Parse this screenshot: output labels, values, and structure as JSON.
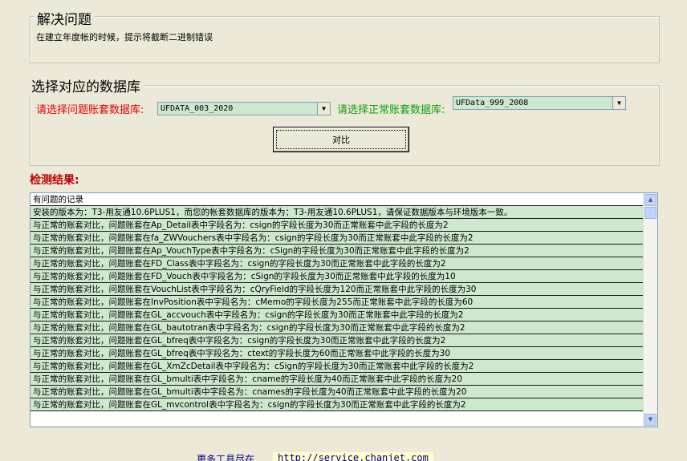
{
  "problem": {
    "title": "解决问题",
    "description": "在建立年度帐的时候，提示将截断二进制错误"
  },
  "database": {
    "title": "选择对应的数据库",
    "problem_label": "请选择问题账套数据库:",
    "problem_value": "UFDATA_003_2020",
    "normal_label": "请选择正常账套数据库:",
    "normal_value": "UFData_999_2008",
    "compare_button": "对比"
  },
  "results": {
    "title": "检测结果:",
    "header": "有问题的记录",
    "rows": [
      "安装的版本为：T3-用友通10.6PLUS1，而您的帐套数据库的版本为：T3-用友通10.6PLUS1，请保证数据版本与环境版本一致。",
      "与正常的账套对比，问题账套在Ap_Detail表中字段名为：csign的字段长度为30而正常账套中此字段的长度为2",
      "与正常的账套对比，问题账套在fa_ZWVouchers表中字段名为：csign的字段长度为30而正常账套中此字段的长度为2",
      "与正常的账套对比，问题账套在Ap_VouchType表中字段名为：cSign的字段长度为30而正常账套中此字段的长度为2",
      "与正常的账套对比，问题账套在FD_Class表中字段名为：csign的字段长度为30而正常账套中此字段的长度为2",
      "与正常的账套对比，问题账套在FD_Vouch表中字段名为：cSign的字段长度为30而正常账套中此字段的长度为10",
      "与正常的账套对比，问题账套在VouchList表中字段名为：cQryField的字段长度为120而正常账套中此字段的长度为30",
      "与正常的账套对比，问题账套在InvPosition表中字段名为：cMemo的字段长度为255而正常账套中此字段的长度为60",
      "与正常的账套对比，问题账套在GL_accvouch表中字段名为：csign的字段长度为30而正常账套中此字段的长度为2",
      "与正常的账套对比，问题账套在GL_bautotran表中字段名为：csign的字段长度为30而正常账套中此字段的长度为2",
      "与正常的账套对比，问题账套在GL_bfreq表中字段名为：csign的字段长度为30而正常账套中此字段的长度为2",
      "与正常的账套对比，问题账套在GL_bfreq表中字段名为：ctext的字段长度为60而正常账套中此字段的长度为30",
      "与正常的账套对比，问题账套在GL_XmZcDetail表中字段名为：cSign的字段长度为30而正常账套中此字段的长度为2",
      "与正常的账套对比，问题账套在GL_bmulti表中字段名为：cname的字段长度为40而正常账套中此字段的长度为20",
      "与正常的账套对比，问题账套在GL_bmulti表中字段名为：cnames的字段长度为40而正常账套中此字段的长度为20",
      "与正常的账套对比，问题账套在GL_mvcontrol表中字段名为：csign的字段长度为30而正常账套中此字段的长度为2"
    ]
  },
  "colors": {
    "problem_label": "#e00000",
    "normal_label": "#10a010",
    "results_title": "#c00000",
    "row_bg": "#cde8cd",
    "footer_link": "#000080"
  },
  "footer": {
    "label": "更多工具尽在",
    "url": "http://service.chanjet.com"
  }
}
